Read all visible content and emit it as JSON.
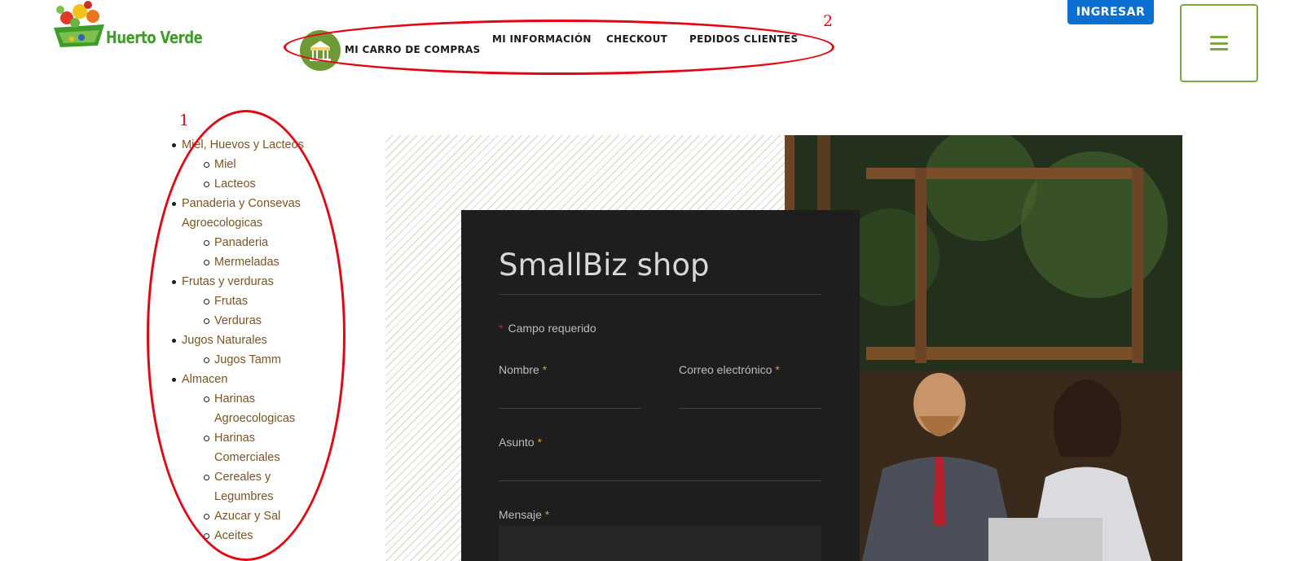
{
  "brand": {
    "name": "Huerto Verde"
  },
  "nav": {
    "cart_label": "MI CARRO DE COMPRAS",
    "items": [
      {
        "label": "MI INFORMACIÓN"
      },
      {
        "label": "CHECKOUT"
      },
      {
        "label": "PEDIDOS CLIENTES"
      }
    ]
  },
  "header": {
    "login_label": "INGRESAR",
    "menu_icon": "hamburger-icon"
  },
  "annotations": [
    {
      "label": "1",
      "color": "#e30613"
    },
    {
      "label": "2",
      "color": "#e30613"
    }
  ],
  "categories": [
    {
      "label": "Miel, Huevos y Lacteos",
      "children": [
        {
          "label": "Miel"
        },
        {
          "label": "Lacteos"
        }
      ]
    },
    {
      "label": "Panaderia y Consevas Agroecologicas",
      "children": [
        {
          "label": "Panaderia"
        },
        {
          "label": "Mermeladas"
        }
      ]
    },
    {
      "label": "Frutas y verduras",
      "children": [
        {
          "label": "Frutas"
        },
        {
          "label": "Verduras"
        }
      ]
    },
    {
      "label": "Jugos Naturales",
      "children": [
        {
          "label": "Jugos Tamm"
        }
      ]
    },
    {
      "label": "Almacen",
      "children": [
        {
          "label": "Harinas Agroecologicas"
        },
        {
          "label": "Harinas Comerciales"
        },
        {
          "label": "Cereales y Legumbres"
        },
        {
          "label": "Azucar y Sal"
        },
        {
          "label": "Aceites"
        }
      ]
    }
  ],
  "form": {
    "title": "SmallBiz shop",
    "required_note": "Campo requerido",
    "required_marker": "*",
    "fields": {
      "name": {
        "label": "Nombre",
        "value": ""
      },
      "email": {
        "label": "Correo electrónico",
        "value": ""
      },
      "subject": {
        "label": "Asunto",
        "value": ""
      },
      "message": {
        "label": "Mensaje",
        "value": ""
      }
    }
  },
  "colors": {
    "brand_green": "#3f9b2a",
    "accent_green": "#7ba83e",
    "login_blue": "#0a6fd1",
    "category_link": "#7a5422",
    "annotation_red": "#e30613",
    "form_bg": "#1e1e1e"
  }
}
